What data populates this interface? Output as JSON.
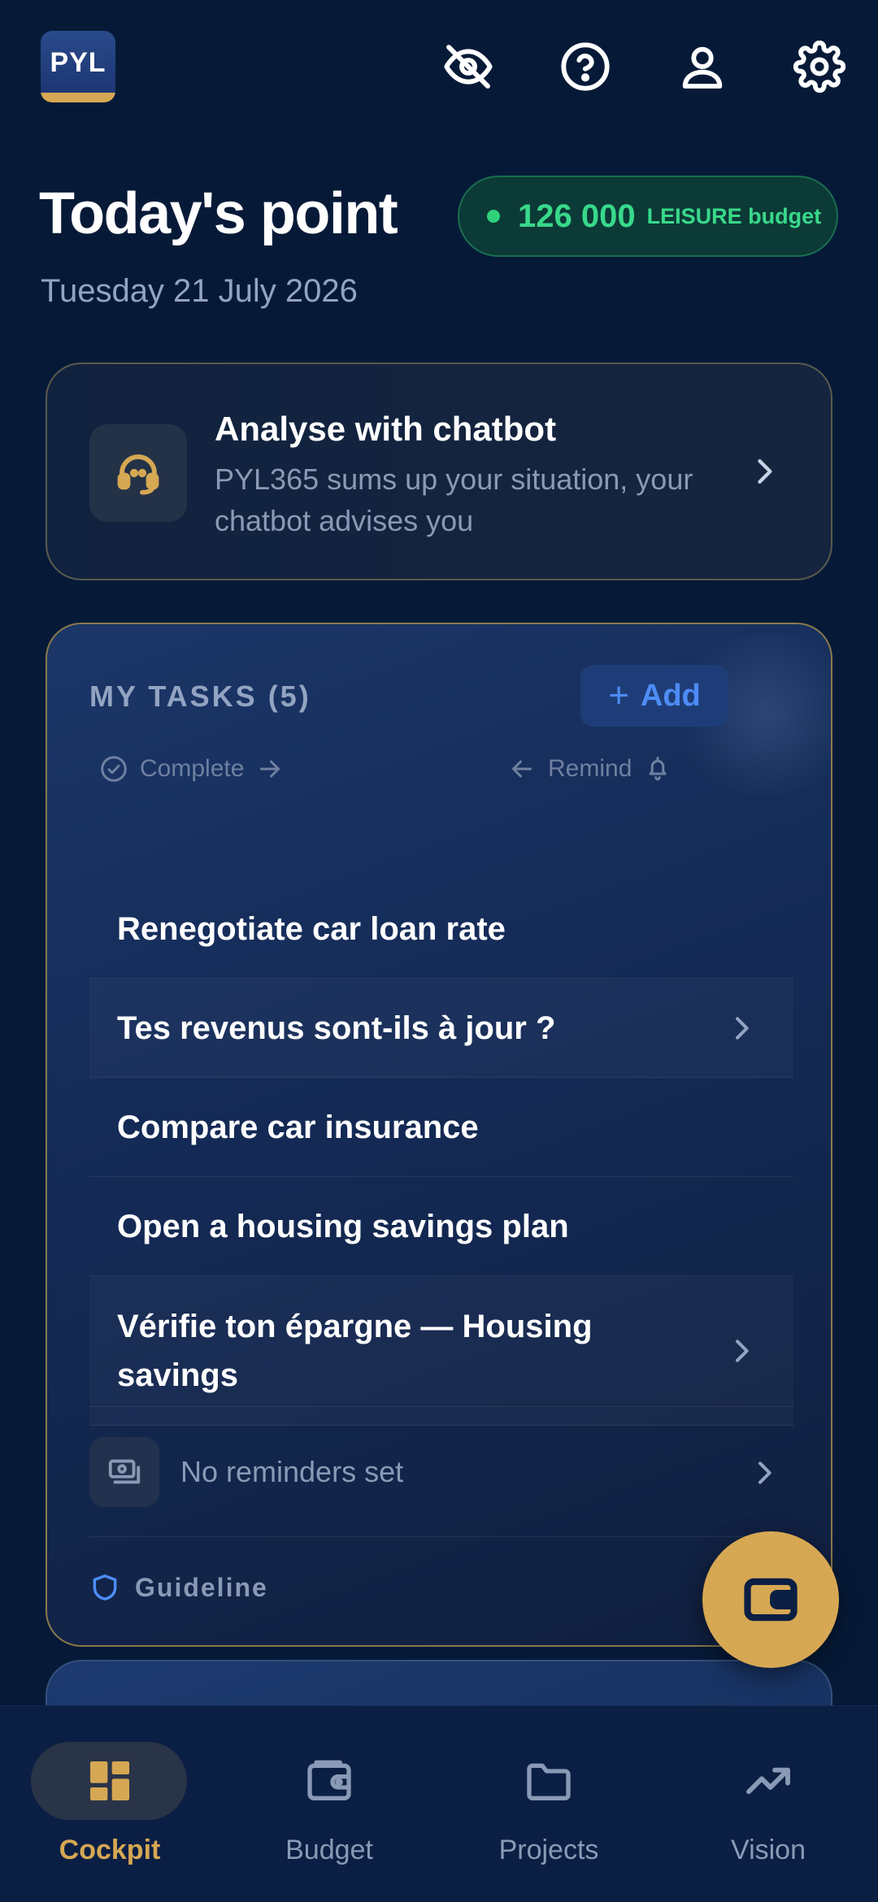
{
  "header": {
    "logo_text": "PYL",
    "icons": [
      "eye-off-icon",
      "help-icon",
      "user-icon",
      "settings-icon"
    ]
  },
  "page": {
    "title": "Today's point",
    "date": "Tuesday 21 July 2026"
  },
  "budget": {
    "amount": "126 000",
    "label": "LEISURE budget",
    "color": "#38d98a"
  },
  "chatbot": {
    "title": "Analyse with chatbot",
    "subtitle": "PYL365 sums up your situation, your chatbot advises you"
  },
  "tasks": {
    "header": "MY TASKS (5)",
    "add_label": "Add",
    "hint_complete": "Complete",
    "hint_remind": "Remind",
    "items": [
      {
        "label": "Renegotiate car loan rate"
      },
      {
        "label": "Tes revenus sont-ils à jour ?"
      },
      {
        "label": "Compare car insurance"
      },
      {
        "label": "Open a housing savings plan"
      },
      {
        "label": "Vérifie ton épargne — Housing savings"
      }
    ],
    "reminders_label": "No reminders set",
    "guideline_label": "Guideline"
  },
  "nav": {
    "items": [
      {
        "label": "Cockpit",
        "icon": "dashboard-icon",
        "active": true
      },
      {
        "label": "Budget",
        "icon": "wallet-icon",
        "active": false
      },
      {
        "label": "Projects",
        "icon": "folder-icon",
        "active": false
      },
      {
        "label": "Vision",
        "icon": "trending-up-icon",
        "active": false
      }
    ]
  },
  "colors": {
    "background": "#061a38",
    "accent_gold": "#d6a853",
    "accent_blue": "#4d8cf5",
    "muted_text": "#8a9ab6"
  }
}
